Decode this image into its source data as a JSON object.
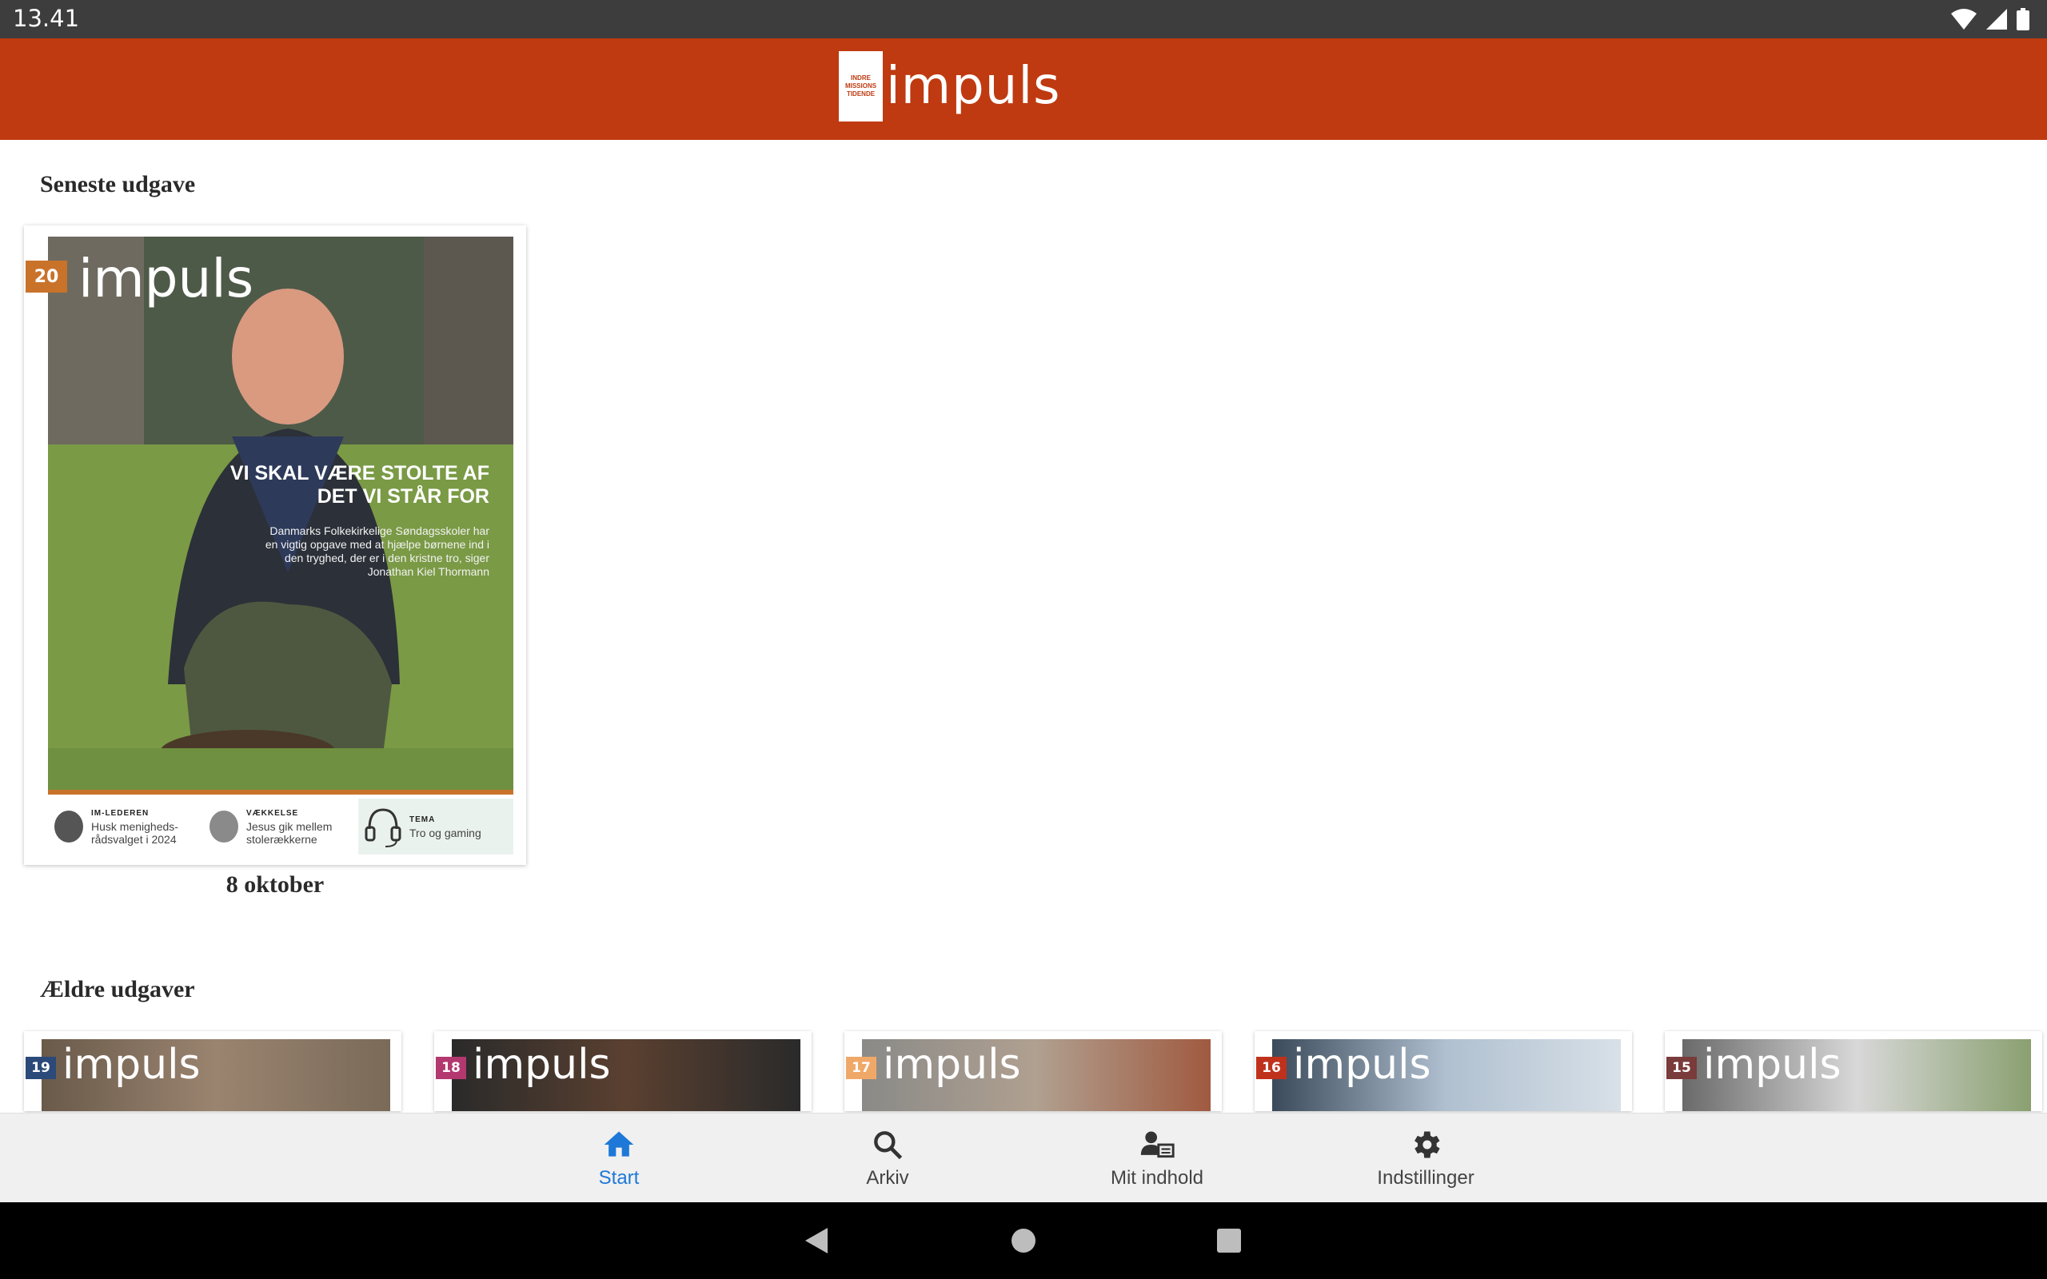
{
  "status_bar": {
    "time": "13.41"
  },
  "header": {
    "logo_box_lines": [
      "INDRE",
      "MISSIONS",
      "TIDENDE"
    ],
    "logo_word": "impuls"
  },
  "latest": {
    "title": "Seneste udgave",
    "caption": "8 oktober",
    "cover": {
      "issue": "20",
      "logo": "impuls",
      "headline": "VI SKAL VÆRE STOLTE AF DET VI STÅR FOR",
      "subtext": "Danmarks Folkekirkelige Søndagsskoler har en vigtig opgave med at hjælpe børnene ind i den tryghed, der er i den kristne tro, siger Jonathan Kiel Thormann",
      "footer": [
        {
          "kicker": "IM-LEDEREN",
          "text": "Husk menigheds-rådsvalget i 2024"
        },
        {
          "kicker": "VÆKKELSE",
          "text": "Jesus gik mellem stolerækkerne"
        },
        {
          "kicker": "TEMA",
          "text": "Tro og gaming"
        }
      ]
    }
  },
  "older": {
    "title": "Ældre udgaver",
    "issues": [
      {
        "issue": "19",
        "logo": "impuls",
        "badge_color": "#2b4a7a"
      },
      {
        "issue": "18",
        "logo": "impuls",
        "badge_color": "#b2386f"
      },
      {
        "issue": "17",
        "logo": "impuls",
        "badge_color": "#f0a868"
      },
      {
        "issue": "16",
        "logo": "impuls",
        "badge_color": "#c0311c"
      },
      {
        "issue": "15",
        "logo": "impuls",
        "badge_color": "#7a3b3b"
      }
    ]
  },
  "bottom_nav": {
    "items": [
      {
        "label": "Start",
        "icon": "home-icon",
        "active": true
      },
      {
        "label": "Arkiv",
        "icon": "search-icon",
        "active": false
      },
      {
        "label": "Mit indhold",
        "icon": "person-content-icon",
        "active": false
      },
      {
        "label": "Indstillinger",
        "icon": "gear-icon",
        "active": false
      }
    ]
  },
  "colors": {
    "brand": "#bf3a10",
    "active_nav": "#1e78d7",
    "status_bar": "#3d3d3d"
  }
}
